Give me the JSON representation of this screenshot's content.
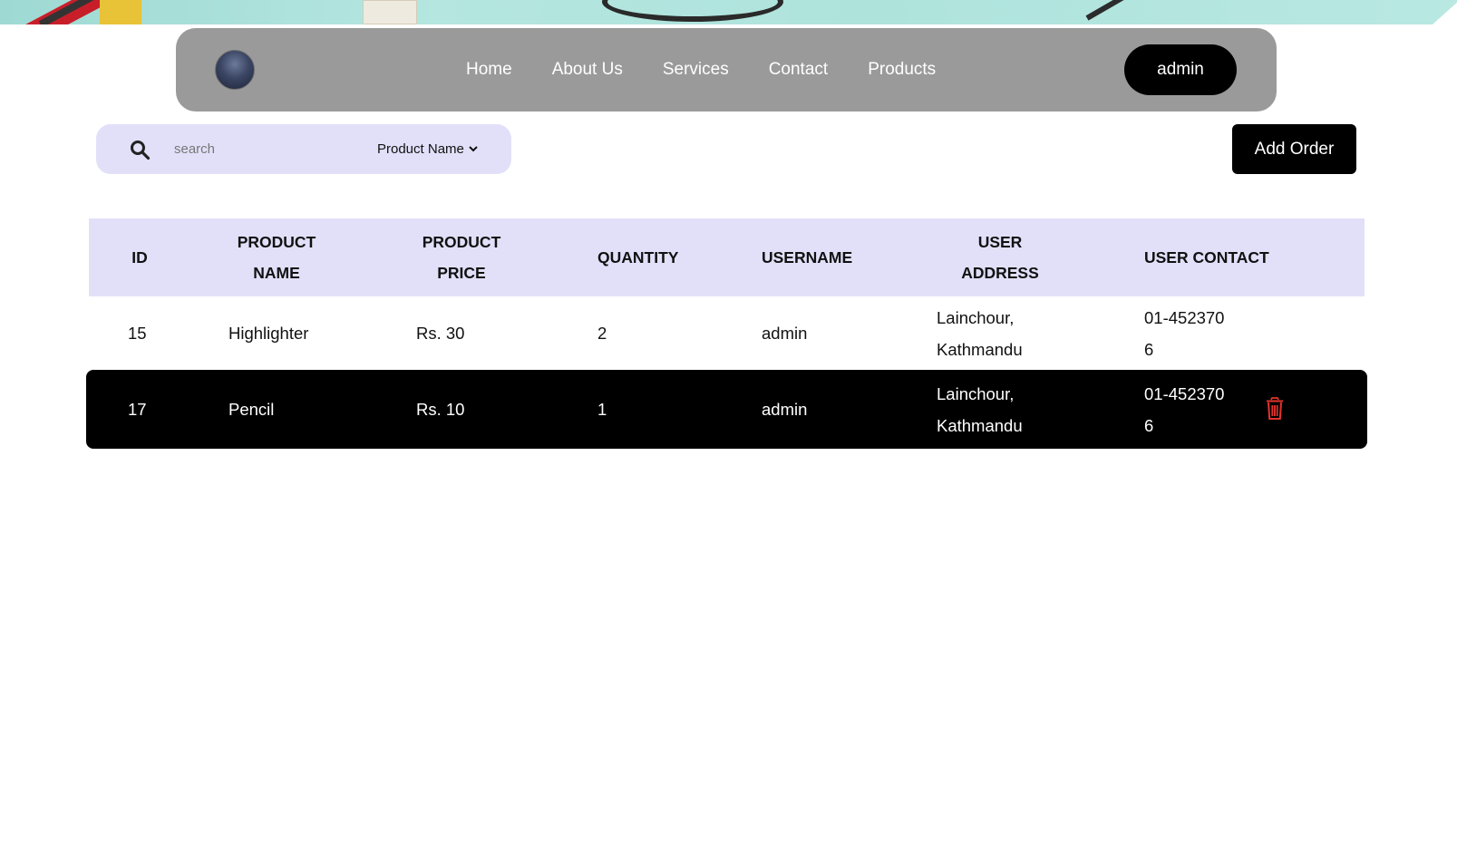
{
  "nav": {
    "links": [
      "Home",
      "About Us",
      "Services",
      "Contact",
      "Products"
    ],
    "user_label": "admin"
  },
  "search": {
    "placeholder": "search",
    "field_selected": "Product Name"
  },
  "actions": {
    "add_order_label": "Add Order"
  },
  "table": {
    "headers": [
      "ID",
      "PRODUCT NAME",
      "PRODUCT PRICE",
      "QUANTITY",
      "USERNAME",
      "USER ADDRESS",
      "USER CONTACT"
    ],
    "rows": [
      {
        "id": "15",
        "product_name": "Highlighter",
        "product_price": "Rs. 30",
        "quantity": "2",
        "username": "admin",
        "user_address": "Lainchour, Kathmandu",
        "user_contact": "01-4523706"
      },
      {
        "id": "17",
        "product_name": "Pencil",
        "product_price": "Rs. 10",
        "quantity": "1",
        "username": "admin",
        "user_address": "Lainchour, Kathmandu",
        "user_contact": "01-4523706"
      }
    ]
  },
  "colors": {
    "navbar_bg": "#9a9a9a",
    "accent_lavender": "#e2e0f9",
    "dark": "#000000",
    "delete_icon": "#e5322d"
  }
}
